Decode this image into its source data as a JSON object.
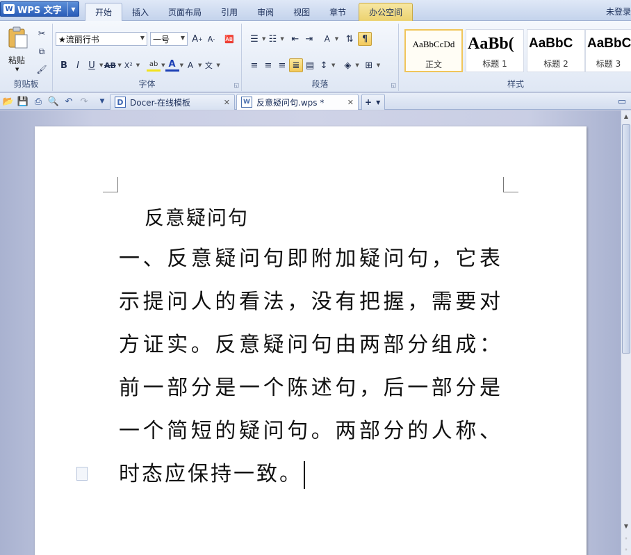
{
  "app": {
    "name": "WPS 文字",
    "login": "未登录"
  },
  "menu_tabs": [
    "开始",
    "插入",
    "页面布局",
    "引用",
    "审阅",
    "视图",
    "章节",
    "办公空间"
  ],
  "ribbon": {
    "clipboard": {
      "paste": "粘贴",
      "label": "剪贴板"
    },
    "font": {
      "family": "★流丽行书",
      "size": "一号",
      "label": "字体"
    },
    "paragraph": {
      "label": "段落"
    },
    "styles": {
      "label": "样式",
      "items": [
        {
          "sample": "AaBbCcDd",
          "name": "正文"
        },
        {
          "sample": "AaBb(",
          "name": "标题 1"
        },
        {
          "sample": "AaBbC",
          "name": "标题 2"
        },
        {
          "sample": "AaBbC",
          "name": "标题 3"
        }
      ]
    }
  },
  "doc_tabs": [
    {
      "label": "Docer-在线模板"
    },
    {
      "label": "反意疑问句.wps *"
    }
  ],
  "document": {
    "title": "反意疑问句",
    "body": "一、反意疑问句即附加疑问句，它表示提问人的看法，没有把握，需要对方证实。反意疑问句由两部分组成：前一部分是一个陈述句，后一部分是一个简短的疑问句。两部分的人称、时态应保持一致。"
  }
}
